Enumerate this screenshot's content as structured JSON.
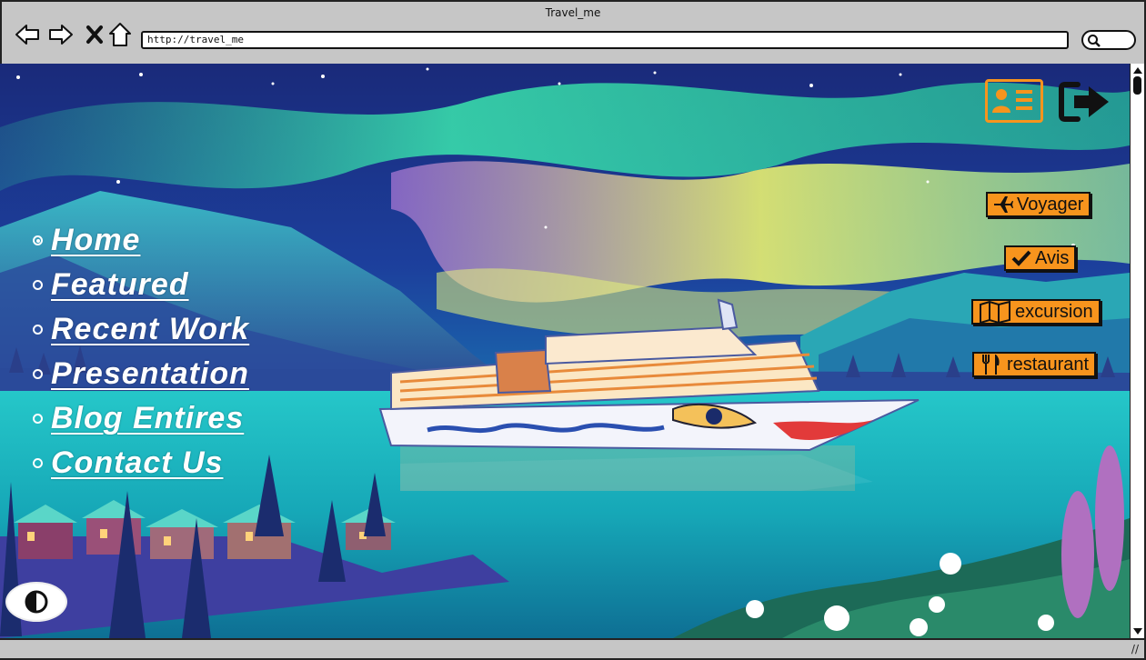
{
  "window": {
    "title": "Travel_me"
  },
  "address_bar": {
    "url": "http://travel_me"
  },
  "nav": {
    "items": [
      {
        "label": "Home",
        "selected": true
      },
      {
        "label": "Featured",
        "selected": false
      },
      {
        "label": "Recent Work",
        "selected": false
      },
      {
        "label": "Presentation",
        "selected": false
      },
      {
        "label": "Blog Entires",
        "selected": false
      },
      {
        "label": "Contact Us",
        "selected": false
      }
    ]
  },
  "actions": {
    "voyager": "Voyager",
    "avis": "Avis",
    "excursion": "excursion",
    "restaurant": "restaurant"
  },
  "icons": {
    "back": "arrow-left-icon",
    "forward": "arrow-right-icon",
    "stop": "close-icon",
    "home": "home-icon",
    "search": "search-icon",
    "profile": "id-card-icon",
    "logout": "sign-out-icon",
    "toggle": "contrast-icon"
  },
  "colors": {
    "accent": "#f7941d",
    "chrome": "#c6c6c6"
  }
}
